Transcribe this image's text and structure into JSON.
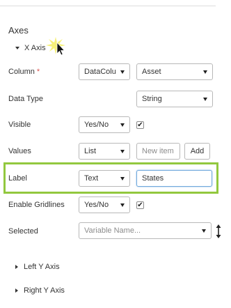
{
  "section": {
    "title": "Axes"
  },
  "x_axis": {
    "label": "X Axis",
    "expanded": true,
    "fields": {
      "column": {
        "label": "Column",
        "required_mark": "*",
        "select1": "DataColu",
        "select2": "Asset"
      },
      "data_type": {
        "label": "Data Type",
        "select": "String"
      },
      "visible": {
        "label": "Visible",
        "select": "Yes/No",
        "checked": true
      },
      "values": {
        "label": "Values",
        "select": "List",
        "new_item_placeholder": "New item",
        "add_label": "Add"
      },
      "label_row": {
        "label": "Label",
        "select": "Text",
        "value": "States"
      },
      "gridlines": {
        "label": "Enable Gridlines",
        "select": "Yes/No",
        "checked": true
      },
      "selected": {
        "label": "Selected",
        "placeholder": "Variable Name..."
      }
    }
  },
  "left_y_axis": {
    "label": "Left Y Axis",
    "expanded": false
  },
  "right_y_axis": {
    "label": "Right Y Axis",
    "expanded": false
  },
  "colors": {
    "highlight": "#92c83e",
    "required": "#d9534f",
    "focus": "#6fa8dc"
  },
  "check_glyph": "✔"
}
